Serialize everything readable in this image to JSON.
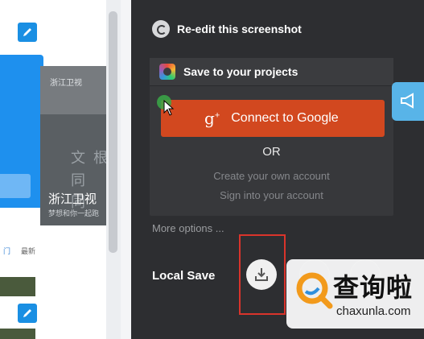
{
  "panel": {
    "reedit_label": "Re-edit this screenshot",
    "projects_label": "Save to your projects",
    "google_button_label": "Connect to Google",
    "google_icon_text": "g",
    "google_icon_sup": "+",
    "or_label": "OR",
    "create_account_label": "Create your own account",
    "sign_in_label": "Sign into your account",
    "more_options_label": "More options ...",
    "local_save_label": "Local Save"
  },
  "background": {
    "tv_logo_text": "浙江卫视",
    "tv_name": "浙江卫视",
    "tv_subtitle": "梦想和你一起跑",
    "tv_chars": [
      "同",
      "文",
      "同",
      "根"
    ],
    "tab_link": "门",
    "tab_new": "最新"
  },
  "watermark": {
    "brand_cn": "查询啦",
    "brand_en": "chaxunla.com"
  },
  "colors": {
    "panel_bg": "#2d2e31",
    "google_red": "#d2481f",
    "highlight_box": "#d9342b",
    "side_tab": "#58b4e8",
    "accent_blue": "#1e90ee",
    "watermark_orange": "#f29a1c"
  },
  "icons": {
    "reedit": "undo-icon",
    "projects": "projects-logo-icon",
    "google": "google-plus-icon",
    "download": "download-icon",
    "side_tab": "megaphone-icon",
    "cursor": "mouse-cursor-icon"
  }
}
